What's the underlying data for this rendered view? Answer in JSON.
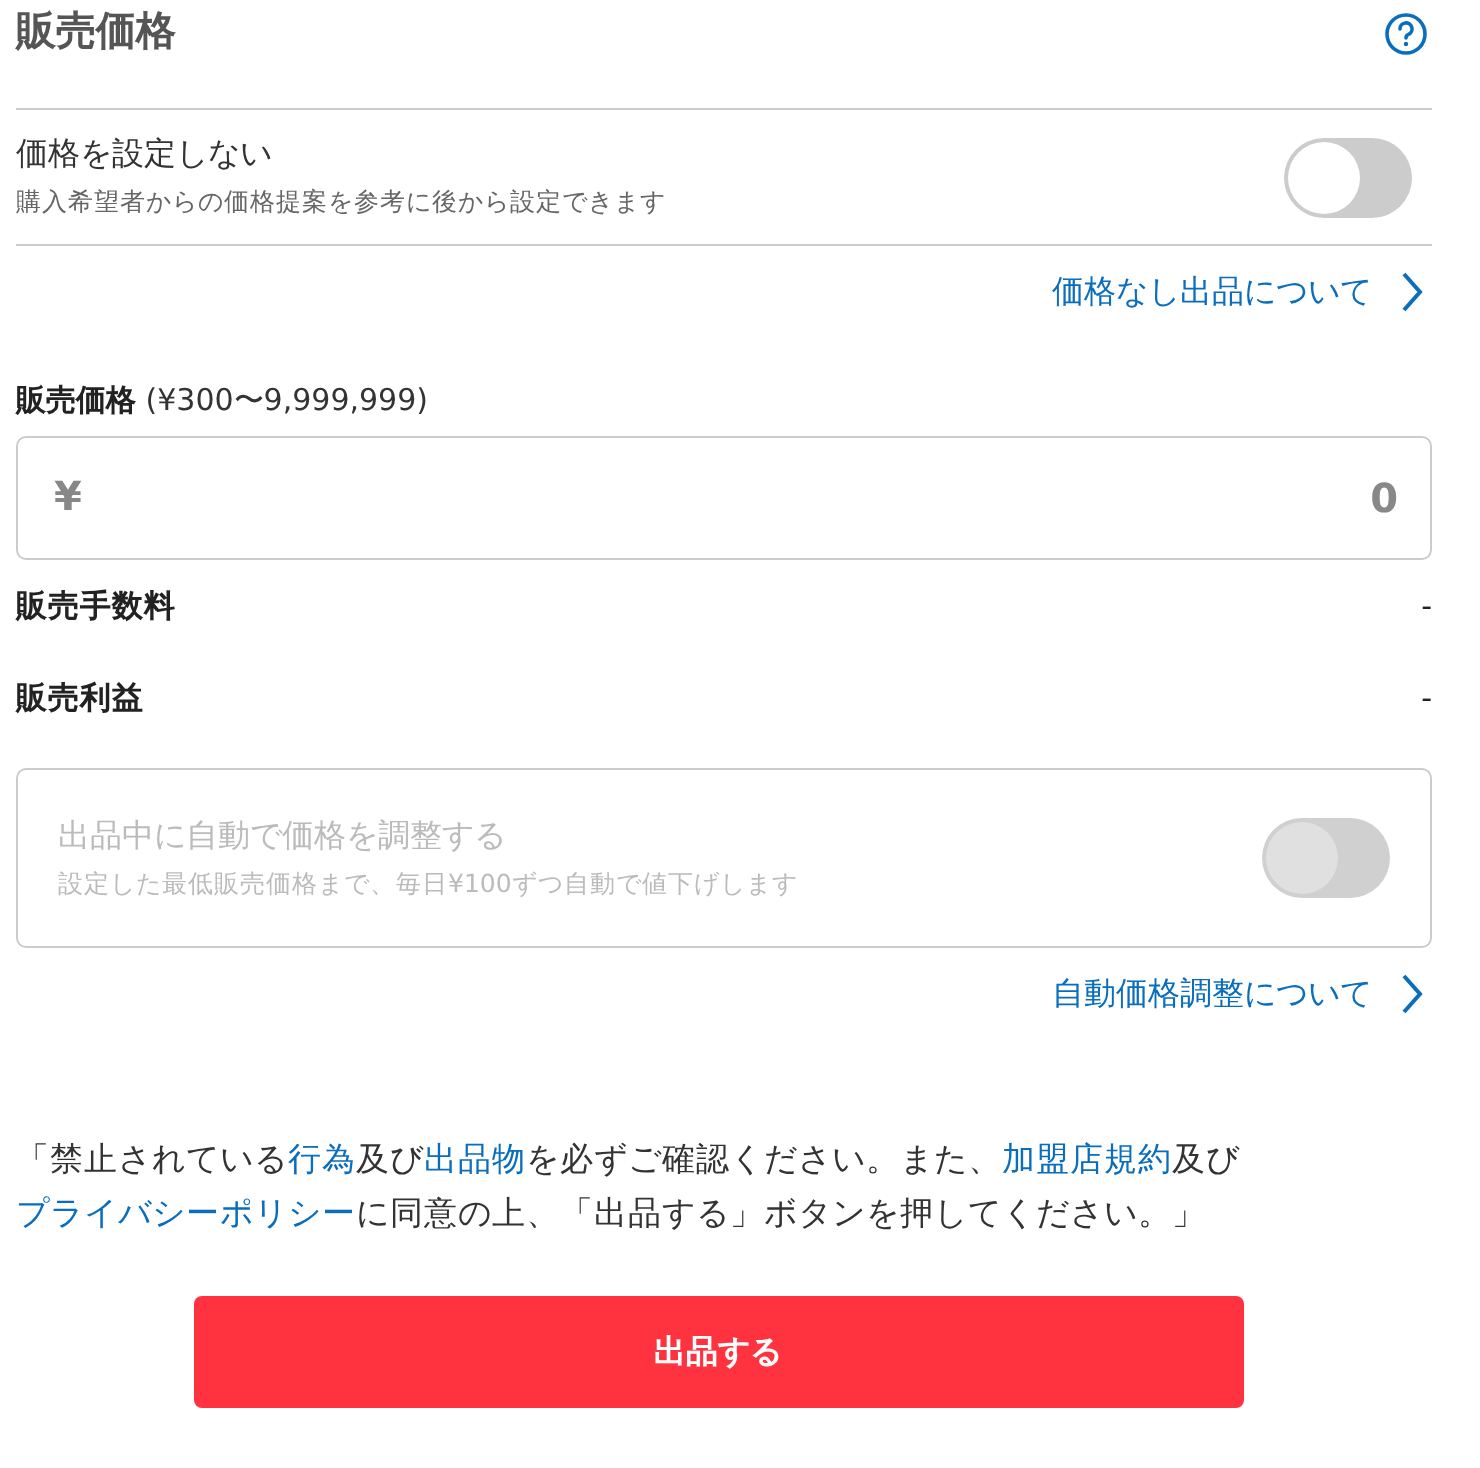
{
  "header": {
    "title": "販売価格"
  },
  "no_price": {
    "label": "価格を設定しない",
    "description": "購入希望者からの価格提案を参考に後から設定できます",
    "on": false
  },
  "no_price_link": "価格なし出品について",
  "price_field": {
    "label": "**販売価格** (¥300〜9,999,999)",
    "currency": "¥",
    "placeholder": "0"
  },
  "summary": [
    {
      "label": "販売手数料",
      "value": "-"
    },
    {
      "label": "販売利益",
      "value": "-"
    }
  ],
  "auto_price": {
    "label": "出品中に自動で価格を調整する",
    "description": "設定した最低販売価格まで、毎日¥100ずつ自動で値下げします",
    "on": false,
    "disabled": true
  },
  "auto_price_link": "自動価格調整について",
  "notice": [
    {
      "text": "「禁止されている",
      "link": false
    },
    {
      "text": "行為",
      "link": true
    },
    {
      "text": "及び",
      "link": false
    },
    {
      "text": "出品物",
      "link": true
    },
    {
      "text": "を必ずご確認ください。また、",
      "link": false
    },
    {
      "text": "加盟店規約",
      "link": true
    },
    {
      "text": "及び",
      "link": false
    },
    {
      "text": "プライバシーポリシー",
      "link": true
    },
    {
      "text": "に同意の上、「出品する」ボタンを押してください。」",
      "link": false
    }
  ],
  "submit_button": "出品する"
}
